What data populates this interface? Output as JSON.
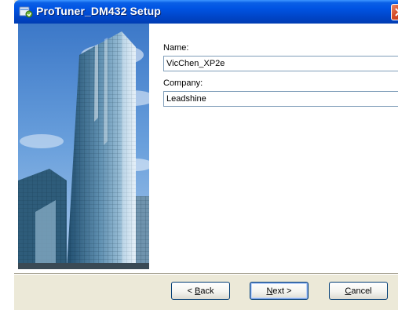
{
  "window": {
    "title": "ProTuner_DM432 Setup",
    "icon": "setup-app-icon"
  },
  "form": {
    "name_label": "Name:",
    "name_value": "VicChen_XP2e",
    "company_label": "Company:",
    "company_value": "Leadshine"
  },
  "buttons": {
    "back_prefix": "< ",
    "back_mnemonic": "B",
    "back_rest": "ack",
    "next_mnemonic": "N",
    "next_rest": "ext >",
    "cancel_mnemonic": "C",
    "cancel_rest": "ancel"
  },
  "colors": {
    "title_bar": "#0054e3",
    "dialog_face": "#ece9d8",
    "field_border": "#7f9db9",
    "close_button": "#d44a25"
  }
}
